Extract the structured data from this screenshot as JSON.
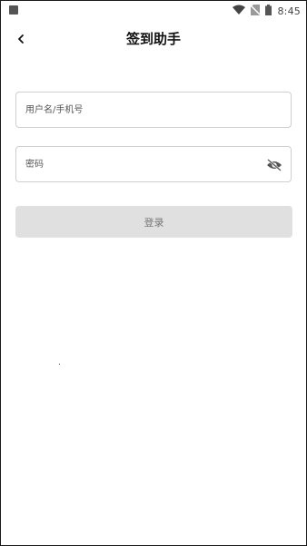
{
  "status_bar": {
    "time": "8:45",
    "icons": [
      "notification-square-icon",
      "wifi-icon",
      "no-sim-icon",
      "battery-icon"
    ]
  },
  "header": {
    "title": "签到助手",
    "back_icon": "chevron-left-icon"
  },
  "form": {
    "username_placeholder": "用户名/手机号",
    "username_value": "",
    "password_placeholder": "密码",
    "password_value": "",
    "password_toggle_icon": "eye-off-icon",
    "login_label": "登录"
  },
  "colors": {
    "background": "#ffffff",
    "border": "#cfcfcf",
    "button_disabled": "#e0e0e0",
    "button_text": "#777777",
    "title": "#111111"
  }
}
